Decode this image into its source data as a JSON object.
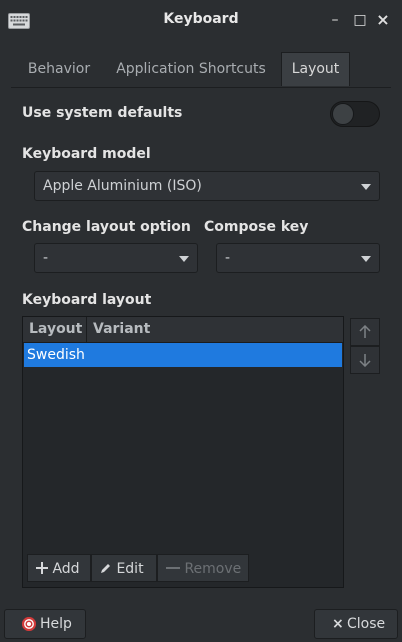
{
  "window": {
    "title": "Keyboard",
    "icon": "keyboard-icon"
  },
  "titlebar_buttons": {
    "minimize": "–",
    "maximize": "□",
    "close": "×"
  },
  "tabs": [
    {
      "label": "Behavior",
      "active": false
    },
    {
      "label": "Application Shortcuts",
      "active": false
    },
    {
      "label": "Layout",
      "active": true
    }
  ],
  "system_defaults": {
    "label": "Use system defaults",
    "enabled": false
  },
  "keyboard_model": {
    "label": "Keyboard model",
    "value": "Apple Aluminium (ISO)"
  },
  "change_layout_option": {
    "label": "Change layout option",
    "value": "-"
  },
  "compose_key": {
    "label": "Compose key",
    "value": "-"
  },
  "keyboard_layout": {
    "label": "Keyboard layout",
    "columns": [
      "Layout",
      "Variant"
    ],
    "rows": [
      {
        "layout": "Swedish",
        "variant": "",
        "selected": true
      }
    ],
    "add_label": "Add",
    "edit_label": "Edit",
    "remove_label": "Remove"
  },
  "buttons": {
    "help": "Help",
    "close": "Close"
  },
  "colors": {
    "accent": "#1f7adf",
    "background": "#2b2e31"
  }
}
